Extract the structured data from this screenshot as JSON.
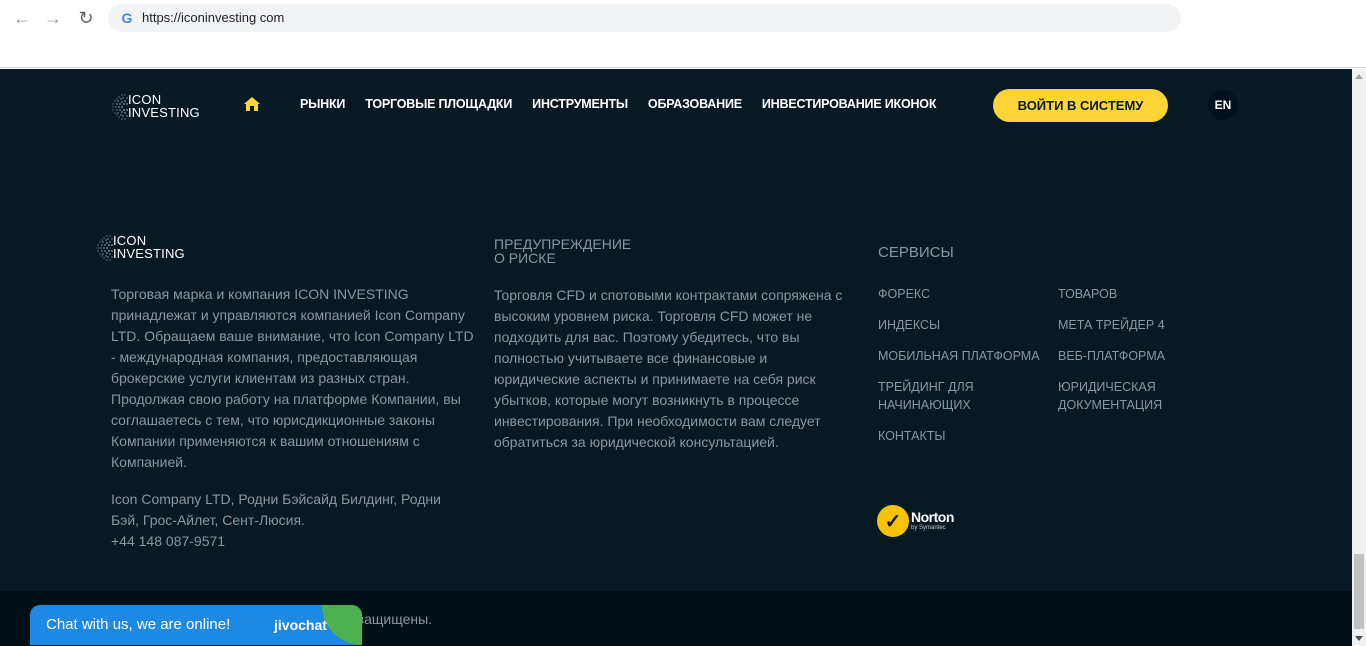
{
  "browser": {
    "url": "https://iconinvesting com"
  },
  "header": {
    "logo_line1": "ICON",
    "logo_line2": "INVESTING",
    "menu": [
      "РЫНКИ",
      "ТОРГОВЫЕ ПЛОЩАДКИ",
      "ИНСТРУМЕНТЫ",
      "ОБРАЗОВАНИЕ",
      "ИНВЕСТИРОВАНИЕ ИКОНОК"
    ],
    "login_label": "ВОЙТИ В СИСТЕМУ",
    "lang_label": "EN"
  },
  "footer": {
    "logo_line1": "ICON",
    "logo_line2": "INVESTING",
    "about": "Торговая марка и компания ICON INVESTING принадлежат и управляются компанией Icon Company LTD. Обращаем ваше внимание, что Icon Company LTD - международная компания, предоставляющая брокерские услуги клиентам из разных стран. Продолжая свою работу на платформе Компании, вы соглашаетесь с тем, что юрисдикционные законы Компании применяются к вашим отношениям с Компанией.",
    "address": "Icon Company LTD, Родни Бэйсайд Билдинг, Родни Бэй, Грос-Айлет, Сент-Люсия.",
    "phone": "+44 148 087-9571",
    "risk_title_line1": "ПРЕДУПРЕЖДЕНИЕ",
    "risk_title_line2": "О РИСКЕ",
    "risk_text": "Торговля CFD и спотовыми контрактами сопряжена с высоким уровнем риска. Торговля CFD может не подходить для вас. Поэтому убедитесь, что вы полностью учитываете все финансовые и юридические аспекты и принимаете на себя риск убытков, которые могут возникнуть в процессе инвестирования. При необходимости вам следует обратиться за юридической консультацией.",
    "services_title": "СЕРВИСЫ",
    "services_col1": [
      "ФОРЕКС",
      "ИНДЕКСЫ",
      "МОБИЛЬНАЯ ПЛАТФОРМА",
      "ТРЕЙДИНГ ДЛЯ НАЧИНАЮЩИХ",
      "КОНТАКТЫ"
    ],
    "services_col2": [
      "ТОВАРОВ",
      "МЕТА ТРЕЙДЕР 4",
      "ВЕБ-ПЛАТФОРМА",
      "ЮРИДИЧЕСКАЯ ДОКУМЕНТАЦИЯ"
    ],
    "norton_name": "Norton",
    "norton_sub": "by Symantec",
    "copyright_visible": "а защищены."
  },
  "chat": {
    "text": "Chat with us, we are online!",
    "brand": "jivochat"
  },
  "colors": {
    "background": "#071a24",
    "accent": "#fcd435",
    "chat_blue": "#1e88e5",
    "chat_green": "#4caf50"
  }
}
